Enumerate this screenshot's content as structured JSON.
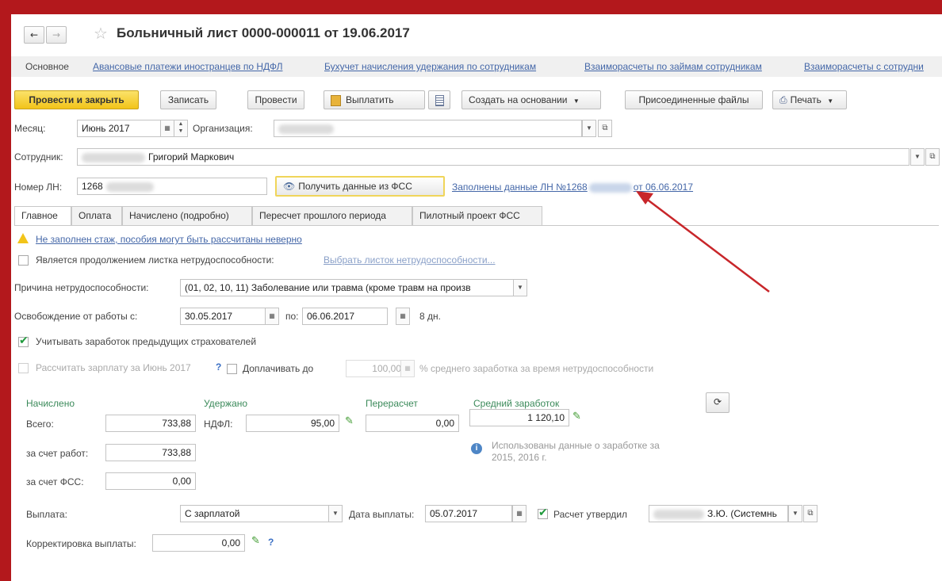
{
  "title": "Больничный лист 0000-000011 от 19.06.2017",
  "nav": {
    "back": "←",
    "forward": "→",
    "star": "☆",
    "links": [
      "Основное",
      "Авансовые платежи иностранцев по НДФЛ",
      "Бухучет начисления удержания по сотрудникам",
      "Взаиморасчеты по займам сотрудникам",
      "Взаиморасчеты с сотрудни"
    ]
  },
  "toolbar": {
    "post_close": "Провести и закрыть",
    "save": "Записать",
    "post": "Провести",
    "pay": "Выплатить",
    "create_based": "Создать на основании",
    "attached": "Присоединенные файлы",
    "print": "Печать"
  },
  "header": {
    "month_label": "Месяц:",
    "month_value": "Июнь 2017",
    "org_label": "Организация:",
    "employee_label": "Сотрудник:",
    "employee_value": "Григорий Маркович",
    "ln_label": "Номер ЛН:",
    "ln_value": "1268",
    "fss_button": "Получить данные из ФСС",
    "filled_link_start": "Заполнены данные ЛН №1268",
    "filled_link_end": "от 06.06.2017"
  },
  "tabs": [
    "Главное",
    "Оплата",
    "Начислено (подробно)",
    "Пересчет прошлого периода",
    "Пилотный проект ФСС"
  ],
  "main": {
    "warning": "Не заполнен стаж, пособия могут быть рассчитаны неверно",
    "continuation_label": "Является продолжением листка нетрудоспособности:",
    "continuation_link": "Выбрать листок нетрудоспособности...",
    "reason_label": "Причина нетрудоспособности:",
    "reason_value": "(01, 02, 10, 11) Заболевание или травма (кроме травм на произв",
    "release_label": "Освобождение от работы с:",
    "release_from": "30.05.2017",
    "release_to_label": "по:",
    "release_to": "06.06.2017",
    "days": "8 дн.",
    "prev_insurers": "Учитывать заработок предыдущих страхователей",
    "calc_salary": "Рассчитать зарплату за Июнь 2017",
    "pay_up_to": "Доплачивать до",
    "pay_up_value": "100,00",
    "pay_up_suffix": "% среднего заработка за время нетрудоспособности",
    "q": "?"
  },
  "totals": {
    "accrued_header": "Начислено",
    "withheld_header": "Удержано",
    "recalc_header": "Перерасчет",
    "avg_header": "Средний заработок",
    "total_label": "Всего:",
    "total_value": "733,88",
    "ndfl_label": "НДФЛ:",
    "ndfl_value": "95,00",
    "recalc_value": "0,00",
    "avg_value": "1 120,10",
    "employer_label": "за счет работ:",
    "employer_value": "733,88",
    "fss_label": "за счет ФСС:",
    "fss_value": "0,00",
    "info_text_1": "Использованы данные о заработке за",
    "info_text_2": "2015, 2016 г."
  },
  "payment": {
    "payment_label": "Выплата:",
    "payment_value": "С зарплатой",
    "date_label": "Дата выплаты:",
    "date_value": "05.07.2017",
    "approved_label": "Расчет утвердил",
    "approved_value": "З.Ю. (Системнь",
    "correction_label": "Корректировка выплаты:",
    "correction_value": "0,00"
  },
  "colors": {
    "frame": "#b3181c",
    "primary_button": "#f2c419",
    "link": "#4467a8",
    "green_header": "#3b8a5a",
    "arrow": "#c8262a"
  }
}
